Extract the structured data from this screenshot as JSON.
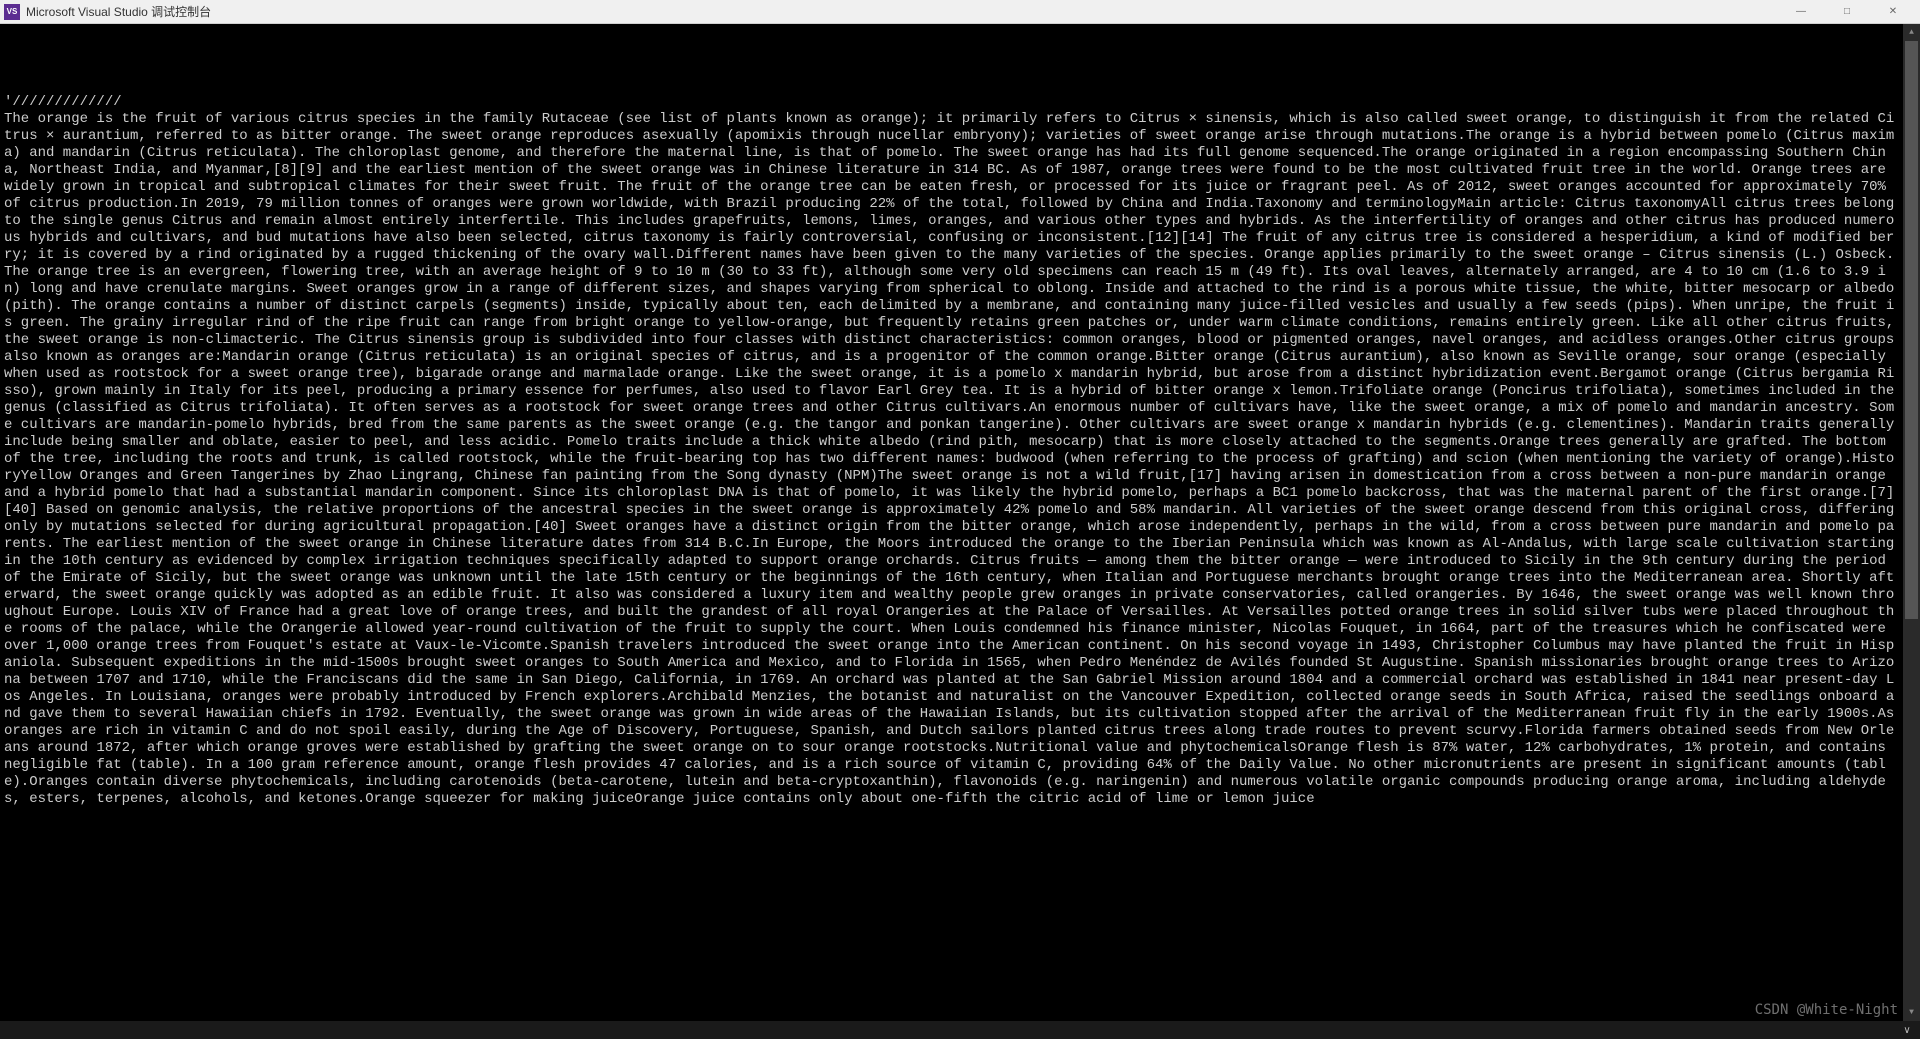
{
  "window": {
    "app_icon_text": "VS",
    "title": "Microsoft Visual Studio 调试控制台",
    "minimize_glyph": "—",
    "maximize_glyph": "□",
    "close_glyph": "✕"
  },
  "console": {
    "header_line": "'/////////////",
    "body": "The orange is the fruit of various citrus species in the family Rutaceae (see list of plants known as orange); it primarily refers to Citrus × sinensis, which is also called sweet orange, to distinguish it from the related Citrus × aurantium, referred to as bitter orange. The sweet orange reproduces asexually (apomixis through nucellar embryony); varieties of sweet orange arise through mutations.The orange is a hybrid between pomelo (Citrus maxima) and mandarin (Citrus reticulata). The chloroplast genome, and therefore the maternal line, is that of pomelo. The sweet orange has had its full genome sequenced.The orange originated in a region encompassing Southern China, Northeast India, and Myanmar,[8][9] and the earliest mention of the sweet orange was in Chinese literature in 314 BC. As of 1987, orange trees were found to be the most cultivated fruit tree in the world. Orange trees are widely grown in tropical and subtropical climates for their sweet fruit. The fruit of the orange tree can be eaten fresh, or processed for its juice or fragrant peel. As of 2012, sweet oranges accounted for approximately 70% of citrus production.In 2019, 79 million tonnes of oranges were grown worldwide, with Brazil producing 22% of the total, followed by China and India.Taxonomy and terminologyMain article: Citrus taxonomyAll citrus trees belong to the single genus Citrus and remain almost entirely interfertile. This includes grapefruits, lemons, limes, oranges, and various other types and hybrids. As the interfertility of oranges and other citrus has produced numerous hybrids and cultivars, and bud mutations have also been selected, citrus taxonomy is fairly controversial, confusing or inconsistent.[12][14] The fruit of any citrus tree is considered a hesperidium, a kind of modified berry; it is covered by a rind originated by a rugged thickening of the ovary wall.Different names have been given to the many varieties of the species. Orange applies primarily to the sweet orange – Citrus sinensis (L.) Osbeck. The orange tree is an evergreen, flowering tree, with an average height of 9 to 10 m (30 to 33 ft), although some very old specimens can reach 15 m (49 ft). Its oval leaves, alternately arranged, are 4 to 10 cm (1.6 to 3.9 in) long and have crenulate margins. Sweet oranges grow in a range of different sizes, and shapes varying from spherical to oblong. Inside and attached to the rind is a porous white tissue, the white, bitter mesocarp or albedo (pith). The orange contains a number of distinct carpels (segments) inside, typically about ten, each delimited by a membrane, and containing many juice-filled vesicles and usually a few seeds (pips). When unripe, the fruit is green. The grainy irregular rind of the ripe fruit can range from bright orange to yellow-orange, but frequently retains green patches or, under warm climate conditions, remains entirely green. Like all other citrus fruits, the sweet orange is non-climacteric. The Citrus sinensis group is subdivided into four classes with distinct characteristics: common oranges, blood or pigmented oranges, navel oranges, and acidless oranges.Other citrus groups also known as oranges are:Mandarin orange (Citrus reticulata) is an original species of citrus, and is a progenitor of the common orange.Bitter orange (Citrus aurantium), also known as Seville orange, sour orange (especially when used as rootstock for a sweet orange tree), bigarade orange and marmalade orange. Like the sweet orange, it is a pomelo x mandarin hybrid, but arose from a distinct hybridization event.Bergamot orange (Citrus bergamia Risso), grown mainly in Italy for its peel, producing a primary essence for perfumes, also used to flavor Earl Grey tea. It is a hybrid of bitter orange x lemon.Trifoliate orange (Poncirus trifoliata), sometimes included in the genus (classified as Citrus trifoliata). It often serves as a rootstock for sweet orange trees and other Citrus cultivars.An enormous number of cultivars have, like the sweet orange, a mix of pomelo and mandarin ancestry. Some cultivars are mandarin-pomelo hybrids, bred from the same parents as the sweet orange (e.g. the tangor and ponkan tangerine). Other cultivars are sweet orange x mandarin hybrids (e.g. clementines). Mandarin traits generally include being smaller and oblate, easier to peel, and less acidic. Pomelo traits include a thick white albedo (rind pith, mesocarp) that is more closely attached to the segments.Orange trees generally are grafted. The bottom of the tree, including the roots and trunk, is called rootstock, while the fruit-bearing top has two different names: budwood (when referring to the process of grafting) and scion (when mentioning the variety of orange).HistoryYellow Oranges and Green Tangerines by Zhao Lingrang, Chinese fan painting from the Song dynasty (NPM)The sweet orange is not a wild fruit,[17] having arisen in domestication from a cross between a non-pure mandarin orange and a hybrid pomelo that had a substantial mandarin component. Since its chloroplast DNA is that of pomelo, it was likely the hybrid pomelo, perhaps a BC1 pomelo backcross, that was the maternal parent of the first orange.[7][40] Based on genomic analysis, the relative proportions of the ancestral species in the sweet orange is approximately 42% pomelo and 58% mandarin. All varieties of the sweet orange descend from this original cross, differing only by mutations selected for during agricultural propagation.[40] Sweet oranges have a distinct origin from the bitter orange, which arose independently, perhaps in the wild, from a cross between pure mandarin and pomelo parents. The earliest mention of the sweet orange in Chinese literature dates from 314 B.C.In Europe, the Moors introduced the orange to the Iberian Peninsula which was known as Al-Andalus, with large scale cultivation starting in the 10th century as evidenced by complex irrigation techniques specifically adapted to support orange orchards. Citrus fruits — among them the bitter orange — were introduced to Sicily in the 9th century during the period of the Emirate of Sicily, but the sweet orange was unknown until the late 15th century or the beginnings of the 16th century, when Italian and Portuguese merchants brought orange trees into the Mediterranean area. Shortly afterward, the sweet orange quickly was adopted as an edible fruit. It also was considered a luxury item and wealthy people grew oranges in private conservatories, called orangeries. By 1646, the sweet orange was well known throughout Europe. Louis XIV of France had a great love of orange trees, and built the grandest of all royal Orangeries at the Palace of Versailles. At Versailles potted orange trees in solid silver tubs were placed throughout the rooms of the palace, while the Orangerie allowed year-round cultivation of the fruit to supply the court. When Louis condemned his finance minister, Nicolas Fouquet, in 1664, part of the treasures which he confiscated were over 1,000 orange trees from Fouquet's estate at Vaux-le-Vicomte.Spanish travelers introduced the sweet orange into the American continent. On his second voyage in 1493, Christopher Columbus may have planted the fruit in Hispaniola. Subsequent expeditions in the mid-1500s brought sweet oranges to South America and Mexico, and to Florida in 1565, when Pedro Menéndez de Avilés founded St Augustine. Spanish missionaries brought orange trees to Arizona between 1707 and 1710, while the Franciscans did the same in San Diego, California, in 1769. An orchard was planted at the San Gabriel Mission around 1804 and a commercial orchard was established in 1841 near present-day Los Angeles. In Louisiana, oranges were probably introduced by French explorers.Archibald Menzies, the botanist and naturalist on the Vancouver Expedition, collected orange seeds in South Africa, raised the seedlings onboard and gave them to several Hawaiian chiefs in 1792. Eventually, the sweet orange was grown in wide areas of the Hawaiian Islands, but its cultivation stopped after the arrival of the Mediterranean fruit fly in the early 1900s.As oranges are rich in vitamin C and do not spoil easily, during the Age of Discovery, Portuguese, Spanish, and Dutch sailors planted citrus trees along trade routes to prevent scurvy.Florida farmers obtained seeds from New Orleans around 1872, after which orange groves were established by grafting the sweet orange on to sour orange rootstocks.Nutritional value and phytochemicalsOrange flesh is 87% water, 12% carbohydrates, 1% protein, and contains negligible fat (table). In a 100 gram reference amount, orange flesh provides 47 calories, and is a rich source of vitamin C, providing 64% of the Daily Value. No other micronutrients are present in significant amounts (table).Oranges contain diverse phytochemicals, including carotenoids (beta-carotene, lutein and beta-cryptoxanthin), flavonoids (e.g. naringenin) and numerous volatile organic compounds producing orange aroma, including aldehydes, esters, terpenes, alcohols, and ketones.Orange squeezer for making juiceOrange juice contains only about one-fifth the citric acid of lime or lemon juice"
  },
  "watermark": "CSDN @White-Night",
  "taskbar": {
    "chevron": "∨"
  }
}
